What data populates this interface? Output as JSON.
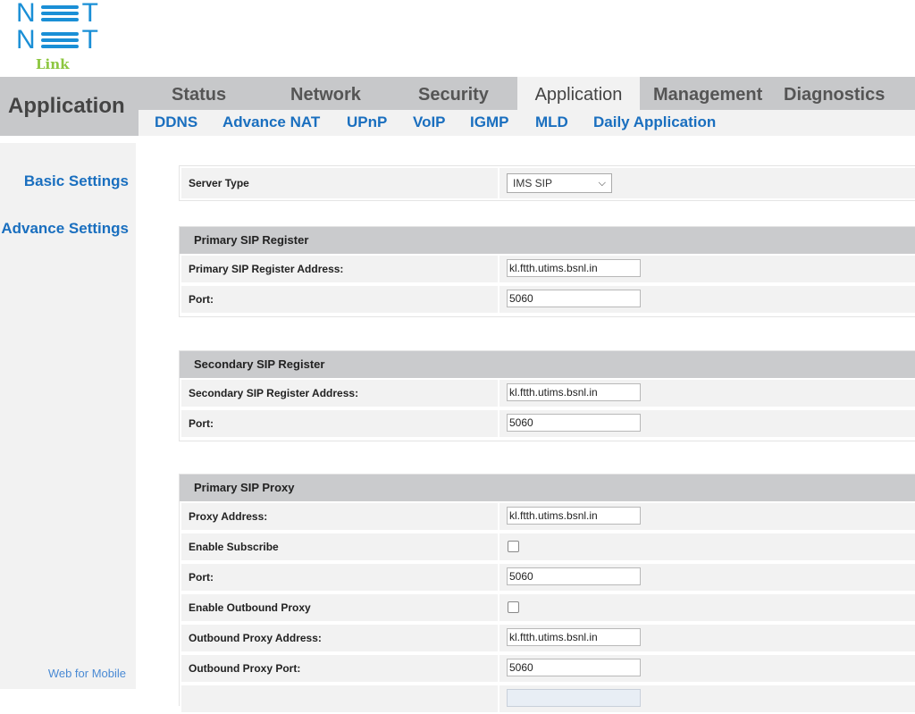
{
  "brand": {
    "line1": "N",
    "line1_end": "T",
    "line2": "N",
    "line2_end": "T",
    "sub": "Link"
  },
  "header": {
    "section_title": "Application",
    "tabs": [
      {
        "label": "Status",
        "active": false
      },
      {
        "label": "Network",
        "active": false
      },
      {
        "label": "Security",
        "active": false
      },
      {
        "label": "Application",
        "active": true
      },
      {
        "label": "Management",
        "active": false
      },
      {
        "label": "Diagnostics",
        "active": false
      }
    ],
    "subtabs": [
      "DDNS",
      "Advance NAT",
      "UPnP",
      "VoIP",
      "IGMP",
      "MLD",
      "Daily Application"
    ]
  },
  "sidebar": {
    "items": [
      "Basic Settings",
      "Advance Settings"
    ],
    "footer_link": "Web for Mobile"
  },
  "form": {
    "server_type": {
      "label": "Server Type",
      "value": "IMS SIP"
    },
    "primary_register": {
      "title": "Primary SIP Register",
      "address_label": "Primary SIP Register Address:",
      "address_value": "kl.ftth.utims.bsnl.in",
      "port_label": "Port:",
      "port_value": "5060"
    },
    "secondary_register": {
      "title": "Secondary SIP Register",
      "address_label": "Secondary SIP Register Address:",
      "address_value": "kl.ftth.utims.bsnl.in",
      "port_label": "Port:",
      "port_value": "5060"
    },
    "primary_proxy": {
      "title": "Primary SIP Proxy",
      "address_label": "Proxy Address:",
      "address_value": "kl.ftth.utims.bsnl.in",
      "subscribe_label": "Enable Subscribe",
      "subscribe_checked": false,
      "port_label": "Port:",
      "port_value": "5060",
      "outbound_enable_label": "Enable Outbound Proxy",
      "outbound_enable_checked": false,
      "outbound_address_label": "Outbound Proxy Address:",
      "outbound_address_value": "kl.ftth.utims.bsnl.in",
      "outbound_port_label": "Outbound Proxy Port:",
      "outbound_port_value": "5060"
    }
  }
}
